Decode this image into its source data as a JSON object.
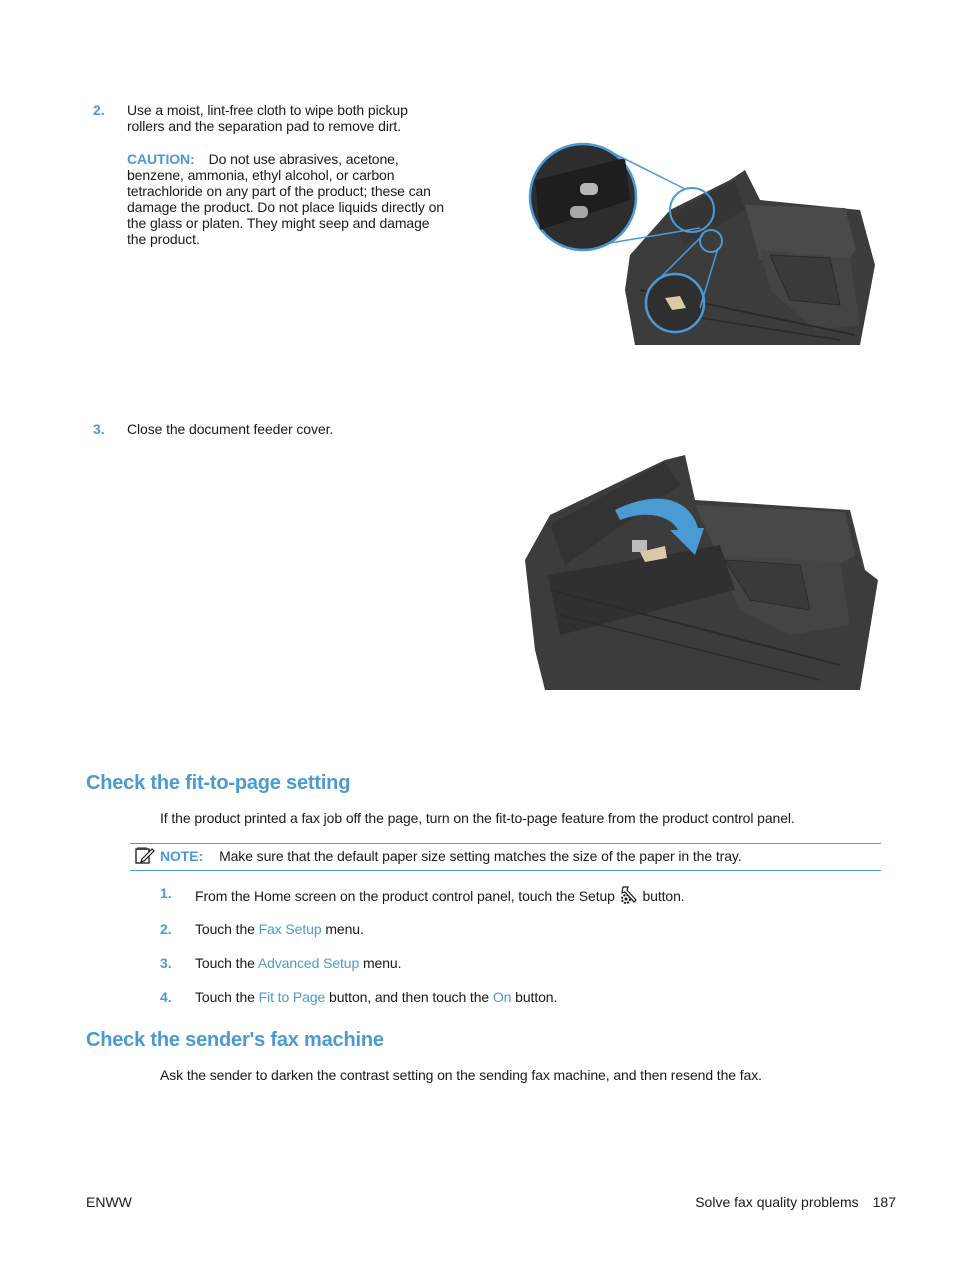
{
  "step2": {
    "number": "2.",
    "text": "Use a moist, lint-free cloth to wipe both pickup rollers and the separation pad to remove dirt.",
    "caution_label": "CAUTION:",
    "caution_text": "Do not use abrasives, acetone, benzene, ammonia, ethyl alcohol, or carbon tetrachloride on any part of the product; these can damage the product. Do not place liquids directly on the glass or platen. They might seep and damage the product."
  },
  "step3": {
    "number": "3.",
    "text": "Close the document feeder cover."
  },
  "figures": {
    "rollers": "printer-rollers-callout-illustration",
    "close_cover": "printer-close-feeder-cover-illustration"
  },
  "section_fit": {
    "title": "Check the fit-to-page setting",
    "intro": "If the product printed a fax job off the page, turn on the fit-to-page feature from the product control panel.",
    "note_label": "NOTE:",
    "note_text": "Make sure that the default paper size setting matches the size of the paper in the tray.",
    "steps": [
      {
        "number": "1.",
        "pre": "From the Home screen on the product control panel, touch the Setup",
        "icon": "setup-icon",
        "post": "button."
      },
      {
        "number": "2.",
        "pre": "Touch the ",
        "link": "Fax Setup",
        "post": " menu."
      },
      {
        "number": "3.",
        "pre": "Touch the ",
        "link": "Advanced Setup",
        "post": " menu."
      },
      {
        "number": "4.",
        "pre": "Touch the ",
        "link": "Fit to Page",
        "mid": " button, and then touch the ",
        "link2": "On",
        "post": " button."
      }
    ]
  },
  "section_sender": {
    "title": "Check the sender's fax machine",
    "text": "Ask the sender to darken the contrast setting on the sending fax machine, and then resend the fax."
  },
  "footer": {
    "left": "ENWW",
    "section": "Solve fax quality problems",
    "page": "187"
  },
  "colors": {
    "accent": "#4a9ad4",
    "printer": "#3a3a3a"
  }
}
